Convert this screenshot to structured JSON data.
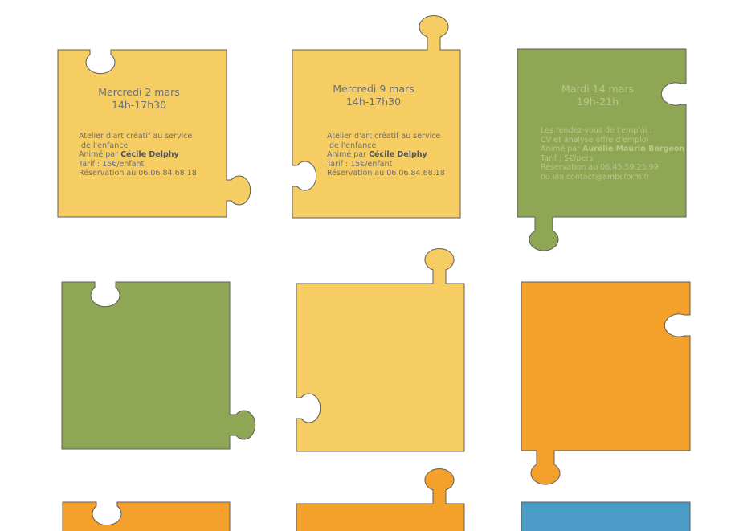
{
  "colors": {
    "yellow": "#f5cd63",
    "green": "#8fa654",
    "orange": "#f4a12b",
    "blue": "#4a9cc6",
    "outline": "#5e5e5e"
  },
  "cards": [
    {
      "title": "Mercredi 2 mars",
      "time": "14h-17h30",
      "lines": [
        "Atelier d'art créatif au service",
        " de l'enfance"
      ],
      "host_prefix": "Animé par ",
      "host_name": "Cécile Delphy",
      "price": "Tarif : 15€/enfant",
      "booking": "Réservation au 06.06.84.68.18"
    },
    {
      "title": "Mercredi 9 mars",
      "time": "14h-17h30",
      "lines": [
        "Atelier d'art créatif au service",
        " de l'enfance"
      ],
      "host_prefix": "Animé par ",
      "host_name": "Cécile Delphy",
      "price": "Tarif : 15€/enfant",
      "booking": "Réservation au 06.06.84.68.18"
    },
    {
      "title": "Mardi 14 mars",
      "time": "19h-21h",
      "lines": [
        "Les rendez-vous de l'emploi :",
        "CV et analyse offre d'emploi"
      ],
      "host_prefix": "Animé par ",
      "host_name": "Aurélie Maurin Bergeon",
      "price": "Tarif : 5€/pers",
      "booking": "Réservation au 06.45.59.25.99",
      "extra": "ou via contact@ambcform.fr"
    }
  ]
}
